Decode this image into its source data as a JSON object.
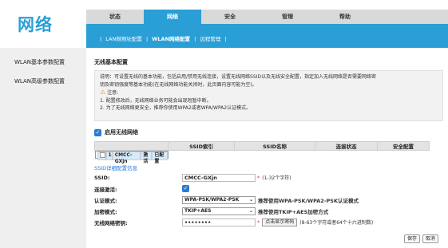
{
  "logo": "网络",
  "topnav": [
    "状态",
    "网络",
    "安全",
    "管理",
    "帮助"
  ],
  "subnav": {
    "items": [
      {
        "label": "LAN侧地址配置",
        "active": false
      },
      {
        "label": "WLAN网络配置",
        "active": true
      },
      {
        "label": "远程管理",
        "active": false
      }
    ]
  },
  "sidebar": {
    "items": [
      "WLAN基本参数配置",
      "WLAN高级参数配置"
    ]
  },
  "section": {
    "title": "无线基本配置",
    "note_lines": [
      "说明：可设置无线的基本功能，包括启用/禁用无线连接，设置无线网络SSID以及无线安全配置，指定加入无线网络是否需要网络密",
      "钥及密钥强度等基本功能(在无线网络功能关闭时，此页面内容可能为空)。",
      "注意:",
      "1. 配置修改后，无线网络业务可能会出现短暂中断。",
      "2. 为了无线网络更安全，推荐你使用WPA2或者WPA/WPA2认证模式。"
    ]
  },
  "enable_wifi": {
    "label": "启用无线网络",
    "checked": true
  },
  "table": {
    "headers": [
      "",
      "SSID索引",
      "SSID名称",
      "连接状态",
      "安全配置"
    ],
    "rows": [
      [
        "",
        "1",
        "CMCC-GXjn",
        "激活",
        "已配置"
      ]
    ]
  },
  "detail": {
    "title": "SSID详细配置信息",
    "ssid_label": "SSID:",
    "ssid_value": "CMCC-GXjn",
    "ssid_hint": "(1-32个字符)",
    "active_label": "连接激活:",
    "auth_label": "认证模式:",
    "auth_value": "WPA-PSK/WPA2-PSK",
    "auth_hint": "推荐使用WPA-PSK/WPA2-PSK认证模式",
    "enc_label": "加密模式:",
    "enc_value": "TKIP+AES",
    "enc_hint": "推荐使用TKIP+AES加密方式",
    "key_label": "无线网络密钥:",
    "key_value": "••••••••",
    "show_key_button": "点击显示密码",
    "key_hint": "(8-63个字符或者64个十六进制数)"
  },
  "actions": {
    "save": "保存",
    "cancel": "取消"
  },
  "colors": {
    "accent": "#2a9fd6",
    "required": "#e03030"
  }
}
